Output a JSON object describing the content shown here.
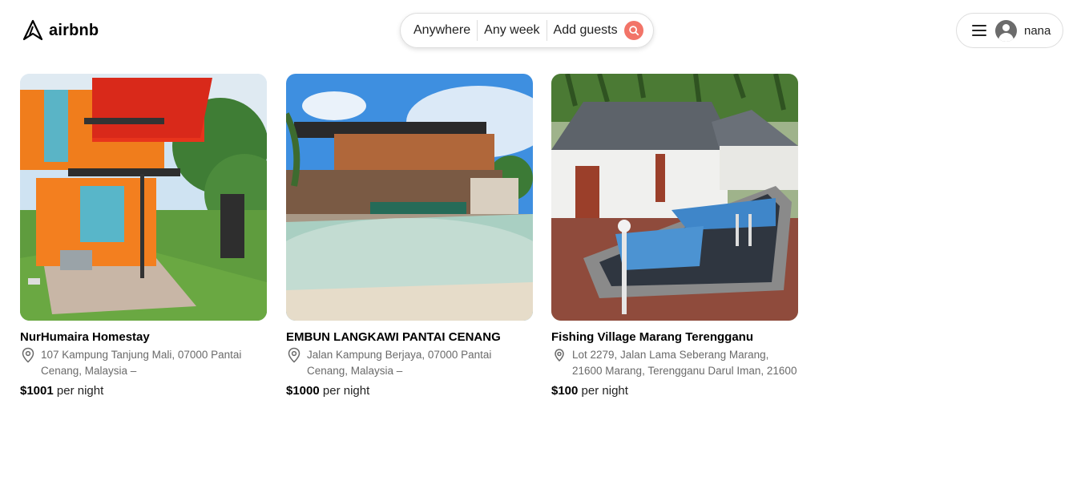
{
  "brand": {
    "logo_icon": "airbnb-logo-icon",
    "name": "airbnb"
  },
  "search": {
    "where": "Anywhere",
    "when": "Any week",
    "guests": "Add guests",
    "button_icon": "search-icon",
    "button_color": "#f27468"
  },
  "user": {
    "menu_icon": "hamburger-icon",
    "avatar_icon": "user-avatar-icon",
    "name": "nana"
  },
  "listings": [
    {
      "title": "NurHumaira Homestay",
      "address": "107 Kampung Tanjung Mali, 07000 Pantai Cenang, Malaysia –",
      "price": "$1001",
      "price_suffix": "per night",
      "image": "orange shipping-container two-storey house with garden"
    },
    {
      "title": "EMBUN LANGKAWI PANTAI CENANG",
      "address": "Jalan Kampung Berjaya, 07000 Pantai Cenang, Malaysia –",
      "price": "$1000",
      "price_suffix": "per night",
      "image": "modern villa with sandy-beach lagoon pool"
    },
    {
      "title": "Fishing Village Marang Terengganu",
      "address": "Lot 2279, Jalan Lama Seberang Marang, 21600 Marang, Terengganu Darul Iman, 21600",
      "price": "$100",
      "price_suffix": "per night",
      "image": "bungalow with tiled swimming pool and palm trees"
    }
  ],
  "colors": {
    "accent": "#f27468",
    "muted_text": "#6a6a6a",
    "border": "#dddddd"
  }
}
